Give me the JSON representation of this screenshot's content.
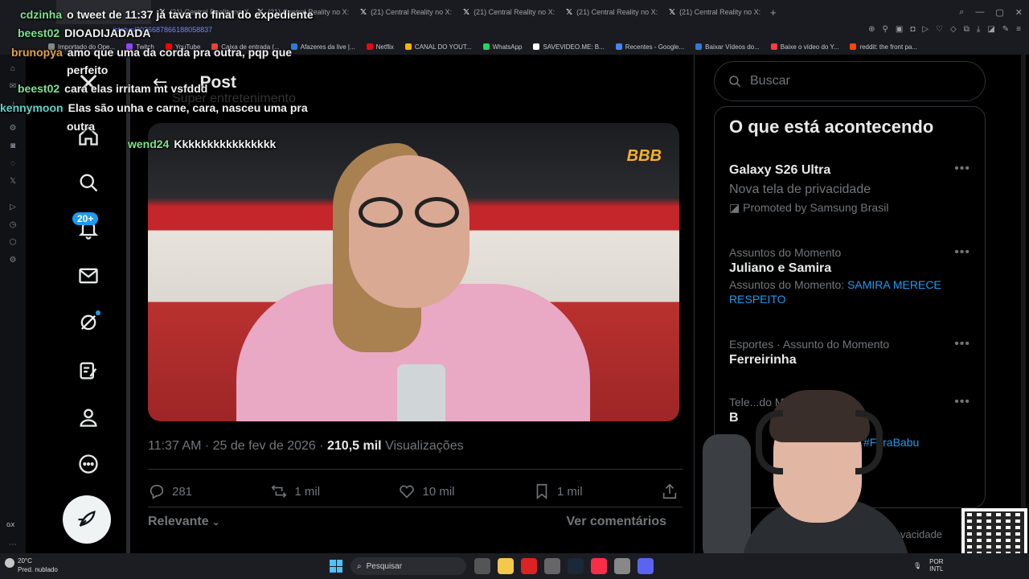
{
  "browser": {
    "tabs": [
      {
        "label": ""
      },
      {
        "label": ""
      },
      {
        "label": "(21) Central Reality no X:"
      },
      {
        "label": "(21) Central Reality no X:"
      },
      {
        "label": "(21) Central Reality no X:"
      },
      {
        "label": "(21) Central Reality no X:"
      },
      {
        "label": "(21) Central Reality no X:"
      },
      {
        "label": "(21) Central Reality no X:"
      }
    ],
    "url": "/status/2026687866188058837",
    "bookmarks": [
      {
        "label": "Importado do Ope...",
        "color": "#888888"
      },
      {
        "label": "Twitch",
        "color": "#9146ff"
      },
      {
        "label": "YouTube",
        "color": "#ff0000"
      },
      {
        "label": "Caixa de entrada (...",
        "color": "#ea4335"
      },
      {
        "label": "Afazeres da live |...",
        "color": "#2d7bd6"
      },
      {
        "label": "Netflix",
        "color": "#e50914"
      },
      {
        "label": "CANAL DO YOUT...",
        "color": "#f4b400"
      },
      {
        "label": "WhatsApp",
        "color": "#25d366"
      },
      {
        "label": "SAVEVIDEO.ME: B...",
        "color": "#ffffff"
      },
      {
        "label": "Recentes - Google...",
        "color": "#4285f4"
      },
      {
        "label": "Baixar Vídeos do...",
        "color": "#2d7bd6"
      },
      {
        "label": "Baixe o vídeo do Y...",
        "color": "#ff3b3b"
      },
      {
        "label": "reddit: the front pa...",
        "color": "#ff4500"
      }
    ],
    "sidebar_label": "GX"
  },
  "xnav": {
    "notifications_badge": "20+"
  },
  "post": {
    "back_label": "←",
    "title": "Post",
    "ghost_text": "Super entretenimento",
    "media_watermark": "BBB",
    "time": "11:37 AM",
    "date": "25 de fev de 2026",
    "views_count": "210,5 mil",
    "views_label": "Visualizações",
    "replies": "281",
    "reposts": "1 mil",
    "likes": "10 mil",
    "bookmarks": "1 mil",
    "sort_label": "Relevante",
    "view_comments": "Ver comentários"
  },
  "sidebar": {
    "search_placeholder": "Buscar",
    "trends_title": "O que está acontecendo",
    "trends": [
      {
        "name": "Galaxy S26 Ultra",
        "ctx": "Nova tela de privacidade",
        "promo": "Promoted by Samsung Brasil"
      },
      {
        "ctx": "Assuntos do Momento",
        "name": "Juliano e Samira",
        "sub_prefix": "Assuntos do Momento:",
        "sub_link": "SAMIRA MERECE RESPEITO"
      },
      {
        "ctx": "Esportes · Assunto do Momento",
        "name": "Ferreirinha"
      },
      {
        "ctx": "Tele...do Momento",
        "name": "B",
        "link": "#ForaBabu"
      }
    ],
    "footer_partial": "vacidade"
  },
  "chat": [
    {
      "user": "cdzinha",
      "color": "#7be38a",
      "msg": "o tweet de 11:37 já tava no final do expediente"
    },
    {
      "user": "beest02",
      "color": "#7be38a",
      "msg": "DIOADIJADADA"
    },
    {
      "user": "brunopya",
      "color": "#e3a04a",
      "msg": "amo que uma da corda pra outra, pqp que"
    },
    {
      "user": "",
      "color": "#ffffff",
      "msg": "perfeito"
    },
    {
      "user": "beest02",
      "color": "#7be38a",
      "msg": "cara elas irritam mt vsfddd"
    },
    {
      "user": "kennymoon",
      "color": "#5fd3c8",
      "msg": "Elas são unha e carne, cara, nasceu uma pra"
    },
    {
      "user": "",
      "color": "#ffffff",
      "msg": "outra"
    },
    {
      "user": "wend24",
      "color": "#7be38a",
      "msg": "Kkkkkkkkkkkkkkkk"
    }
  ],
  "taskbar": {
    "temp": "20°C",
    "weather": "Pred. nublado",
    "search": "Pesquisar",
    "lang": "POR",
    "layout": "INTL"
  },
  "colors": {
    "accent": "#1d9bf0",
    "bg": "#000000",
    "text": "#e7e9ea",
    "muted": "#71767b"
  }
}
